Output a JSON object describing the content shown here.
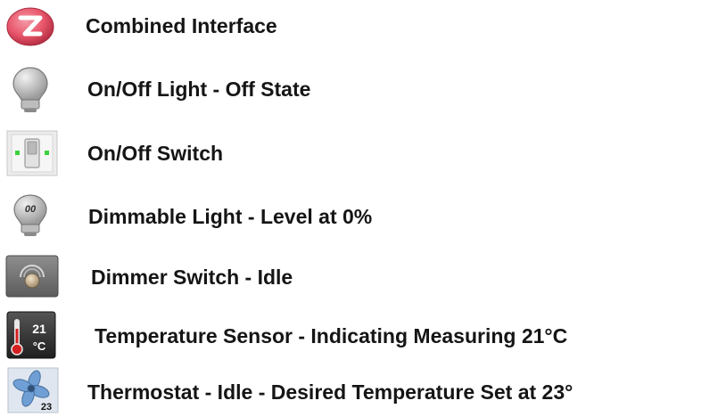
{
  "legend": {
    "items": [
      {
        "icon": "zigbee-logo-icon",
        "label": "Combined Interface"
      },
      {
        "icon": "light-bulb-off-icon",
        "label": "On/Off Light - Off State"
      },
      {
        "icon": "on-off-switch-icon",
        "label": "On/Off Switch"
      },
      {
        "icon": "dimmable-light-icon",
        "label": "Dimmable Light - Level at 0%",
        "icon_text": "00"
      },
      {
        "icon": "dimmer-switch-icon",
        "label": "Dimmer Switch - Idle"
      },
      {
        "icon": "temperature-sensor-icon",
        "label": "Temperature Sensor - Indicating Measuring 21°C",
        "icon_text": "21",
        "icon_unit": "°C"
      },
      {
        "icon": "thermostat-fan-icon",
        "label": "Thermostat - Idle - Desired Temperature Set at 23°",
        "icon_text": "23"
      }
    ]
  },
  "colors": {
    "zigbee_red": "#e8566b",
    "switch_green": "#3bd23b",
    "sensor_bg": "#3a3a3a",
    "thermometer_red": "#d42020",
    "fan_blue": "#6f9fd4"
  }
}
